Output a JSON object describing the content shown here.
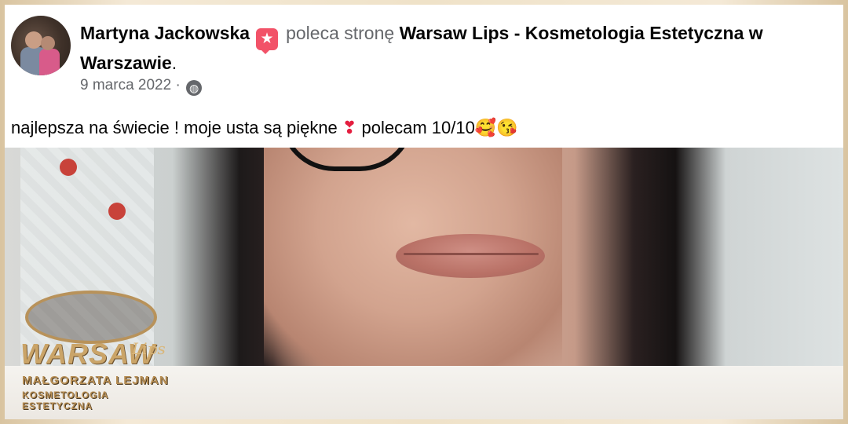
{
  "post": {
    "author": "Martyna Jackowska",
    "badge_icon": "recommend-icon",
    "verb": "poleca stronę",
    "page_name": "Warsaw Lips - Kosmetologia Estetyczna w Warszawie",
    "page_suffix": ".",
    "date": "9 marca 2022",
    "separator": "·",
    "privacy_icon": "globe-icon",
    "text_part1": "najlepsza na świecie ! moje usta są piękne",
    "heart_emoji": "❣",
    "text_part2": "polecam 10/10",
    "emoji_end": "🥰😘"
  },
  "logo": {
    "brand": "WARSAW",
    "script": "Lips",
    "owner": "MAŁGORZATA LEJMAN",
    "subtitle": "KOSMETOLOGIA ESTETYCZNA"
  },
  "colors": {
    "text": "#050505",
    "secondary": "#65676b",
    "badge": "#f25268",
    "gold": "#caa468"
  }
}
